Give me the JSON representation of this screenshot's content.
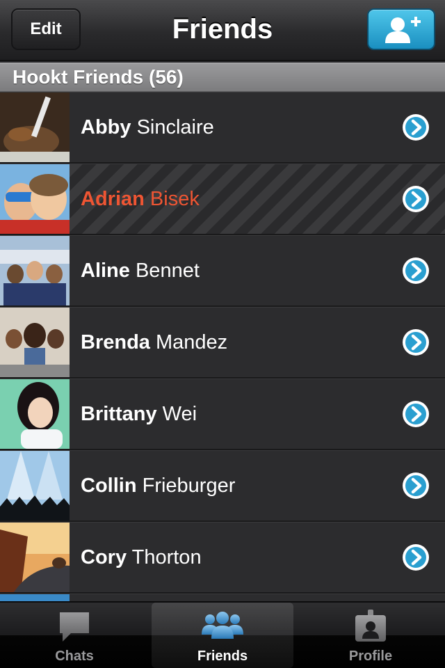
{
  "navbar": {
    "title": "Friends",
    "edit_label": "Edit",
    "add_icon": "add-friend-icon"
  },
  "section": {
    "title": "Hookt Friends (56)"
  },
  "friends": [
    {
      "first": "Abby",
      "last": "Sinclaire",
      "selected": false
    },
    {
      "first": "Adrian",
      "last": "Bisek",
      "selected": true
    },
    {
      "first": "Aline",
      "last": "Bennet",
      "selected": false
    },
    {
      "first": "Brenda",
      "last": "Mandez",
      "selected": false
    },
    {
      "first": "Brittany",
      "last": "Wei",
      "selected": false
    },
    {
      "first": "Collin",
      "last": "Frieburger",
      "selected": false
    },
    {
      "first": "Cory",
      "last": "Thorton",
      "selected": false
    }
  ],
  "tabs": [
    {
      "label": "Chats",
      "icon": "chat-bubble-icon",
      "active": false
    },
    {
      "label": "Friends",
      "icon": "friends-icon",
      "active": true
    },
    {
      "label": "Profile",
      "icon": "profile-badge-icon",
      "active": false
    }
  ],
  "colors": {
    "accent_blue": "#2a9fd0",
    "selected_name": "#ee5533"
  }
}
